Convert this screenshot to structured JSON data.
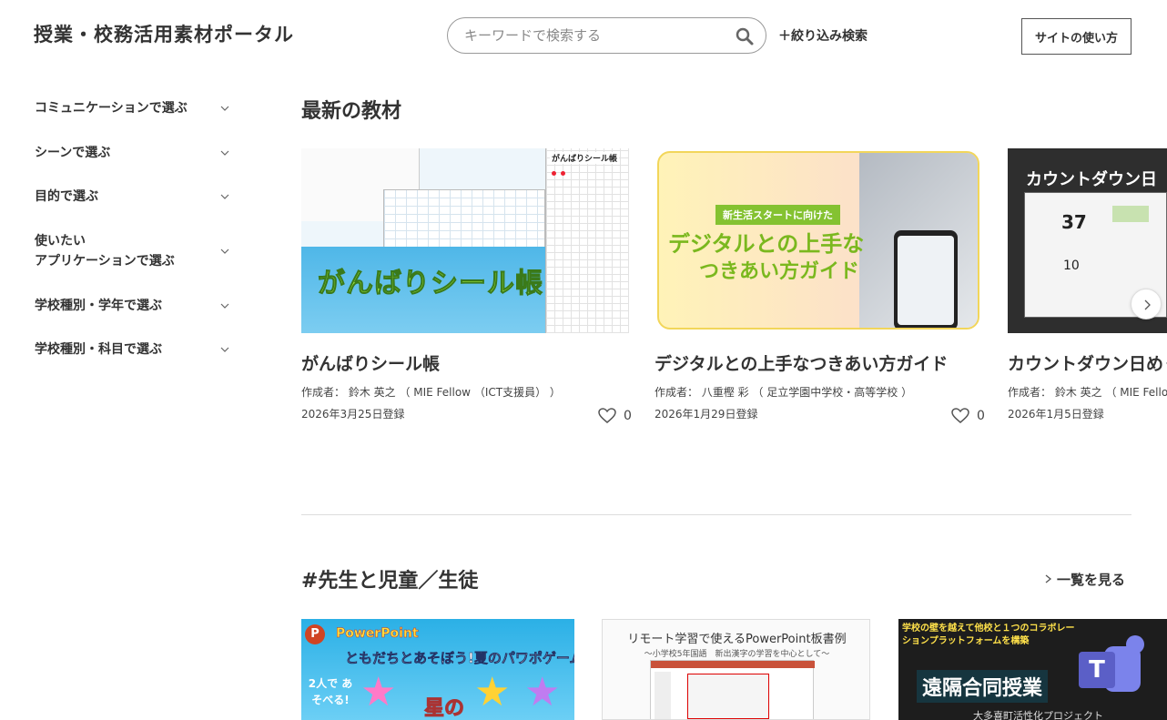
{
  "header": {
    "site_title": "授業・校務活用素材ポータル",
    "search_placeholder": "キーワードで検索する",
    "filter_label": "＋絞り込み検索",
    "usage_button": "サイトの使い方"
  },
  "sidebar": {
    "items": [
      {
        "label": "コミュニケーションで選ぶ"
      },
      {
        "label": "シーンで選ぶ"
      },
      {
        "label": "目的で選ぶ"
      },
      {
        "label_line1": "使いたい",
        "label_line2": "アプリケーションで選ぶ"
      },
      {
        "label": "学校種別・学年で選ぶ"
      },
      {
        "label": "学校種別・科目で選ぶ"
      }
    ]
  },
  "latest": {
    "title": "最新の教材",
    "cards": [
      {
        "title": "がんばりシール帳",
        "thumb_text": "がんばりシール帳",
        "thumb_sheet_label": "がんばりシール帳",
        "author": "作成者：  鈴木 英之 （ MIE Fellow （ICT支援員）  ）",
        "date": "2026年3月25日登録",
        "likes": "0"
      },
      {
        "title": "デジタルとの上手なつきあい方ガイド",
        "thumb_badge": "新生活スタートに向けた",
        "thumb_line1": "デジタルとの上手な",
        "thumb_line2": "つきあい方ガイド",
        "author": "作成者：  八重樫 彩 （ 足立学園中学校・高等学校  ）",
        "date": "2026年1月29日登録",
        "likes": "0"
      },
      {
        "title": "カウントダウン日めくり",
        "thumb_head": "カウントダウン日",
        "thumb_num1": "37",
        "thumb_num2": "10",
        "author": "作成者：  鈴木 英之 （ MIE Fellow （ICT支援員）  ）",
        "date": "2026年1月5日登録"
      }
    ]
  },
  "teachers_section": {
    "title": "#先生と児童／生徒",
    "more_label": "一覧を見る",
    "cards": [
      {
        "ppt_label": "PowerPoint",
        "banner": "ともだちとあそぼう!夏のパワポゲーム",
        "tag": "2人で あそべる!",
        "star_text": "星の"
      },
      {
        "headline": "リモート学習で使えるPowerPoint板書例",
        "sub": "〜小学校5年国語　新出漢字の学習を中心として〜"
      },
      {
        "top": "学校の壁を越えて他校と１つのコラボレーションプラットフォームを構築",
        "main": "遠隔合同授業",
        "bottom": "大多喜町活性化プロジェクト"
      }
    ]
  },
  "colors": {
    "accent_green": "#7ec93a",
    "teams_purple": "#5b5fc7",
    "ppt_orange": "#d04423"
  }
}
